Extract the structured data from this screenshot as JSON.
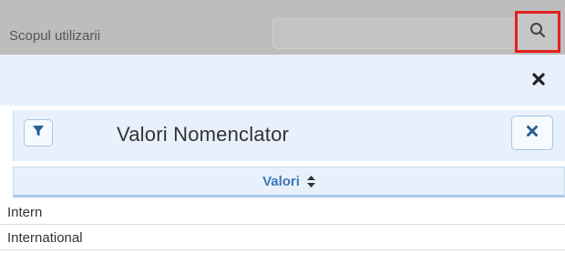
{
  "field": {
    "label": "Scopul utilizarii",
    "search_value": "",
    "search_placeholder": ""
  },
  "icons": {
    "search": "search-icon",
    "close": "close-icon",
    "filter": "filter-icon",
    "clear": "clear-icon",
    "sort": "sort-icon"
  },
  "colors": {
    "highlight": "#e4201e",
    "accent": "#3d79b6",
    "panel_bg": "#e8f1fb",
    "overlay": "#bdbdbd"
  },
  "panel": {
    "title": "Valori Nomenclator"
  },
  "table": {
    "column": "Valori",
    "rows": [
      "Intern",
      "International"
    ]
  }
}
